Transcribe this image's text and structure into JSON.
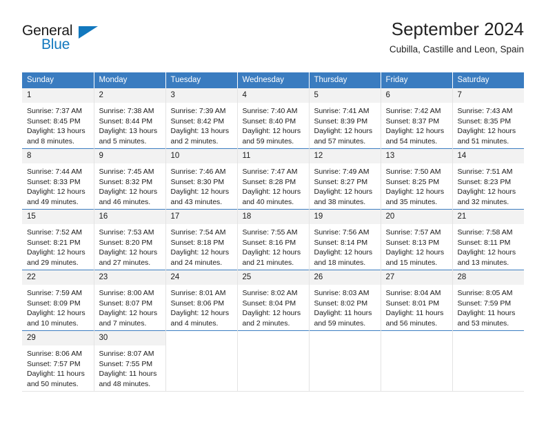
{
  "brand": {
    "line1": "General",
    "line2": "Blue",
    "accent_color": "#1278be"
  },
  "header": {
    "title": "September 2024",
    "subtitle": "Cubilla, Castille and Leon, Spain"
  },
  "calendar": {
    "header_background": "#3a7cc0",
    "daynum_background": "#f2f2f2",
    "weekdays": [
      "Sunday",
      "Monday",
      "Tuesday",
      "Wednesday",
      "Thursday",
      "Friday",
      "Saturday"
    ],
    "weeks": [
      [
        {
          "day": "1",
          "sunrise": "Sunrise: 7:37 AM",
          "sunset": "Sunset: 8:45 PM",
          "daylight_1": "Daylight: 13 hours",
          "daylight_2": "and 8 minutes."
        },
        {
          "day": "2",
          "sunrise": "Sunrise: 7:38 AM",
          "sunset": "Sunset: 8:44 PM",
          "daylight_1": "Daylight: 13 hours",
          "daylight_2": "and 5 minutes."
        },
        {
          "day": "3",
          "sunrise": "Sunrise: 7:39 AM",
          "sunset": "Sunset: 8:42 PM",
          "daylight_1": "Daylight: 13 hours",
          "daylight_2": "and 2 minutes."
        },
        {
          "day": "4",
          "sunrise": "Sunrise: 7:40 AM",
          "sunset": "Sunset: 8:40 PM",
          "daylight_1": "Daylight: 12 hours",
          "daylight_2": "and 59 minutes."
        },
        {
          "day": "5",
          "sunrise": "Sunrise: 7:41 AM",
          "sunset": "Sunset: 8:39 PM",
          "daylight_1": "Daylight: 12 hours",
          "daylight_2": "and 57 minutes."
        },
        {
          "day": "6",
          "sunrise": "Sunrise: 7:42 AM",
          "sunset": "Sunset: 8:37 PM",
          "daylight_1": "Daylight: 12 hours",
          "daylight_2": "and 54 minutes."
        },
        {
          "day": "7",
          "sunrise": "Sunrise: 7:43 AM",
          "sunset": "Sunset: 8:35 PM",
          "daylight_1": "Daylight: 12 hours",
          "daylight_2": "and 51 minutes."
        }
      ],
      [
        {
          "day": "8",
          "sunrise": "Sunrise: 7:44 AM",
          "sunset": "Sunset: 8:33 PM",
          "daylight_1": "Daylight: 12 hours",
          "daylight_2": "and 49 minutes."
        },
        {
          "day": "9",
          "sunrise": "Sunrise: 7:45 AM",
          "sunset": "Sunset: 8:32 PM",
          "daylight_1": "Daylight: 12 hours",
          "daylight_2": "and 46 minutes."
        },
        {
          "day": "10",
          "sunrise": "Sunrise: 7:46 AM",
          "sunset": "Sunset: 8:30 PM",
          "daylight_1": "Daylight: 12 hours",
          "daylight_2": "and 43 minutes."
        },
        {
          "day": "11",
          "sunrise": "Sunrise: 7:47 AM",
          "sunset": "Sunset: 8:28 PM",
          "daylight_1": "Daylight: 12 hours",
          "daylight_2": "and 40 minutes."
        },
        {
          "day": "12",
          "sunrise": "Sunrise: 7:49 AM",
          "sunset": "Sunset: 8:27 PM",
          "daylight_1": "Daylight: 12 hours",
          "daylight_2": "and 38 minutes."
        },
        {
          "day": "13",
          "sunrise": "Sunrise: 7:50 AM",
          "sunset": "Sunset: 8:25 PM",
          "daylight_1": "Daylight: 12 hours",
          "daylight_2": "and 35 minutes."
        },
        {
          "day": "14",
          "sunrise": "Sunrise: 7:51 AM",
          "sunset": "Sunset: 8:23 PM",
          "daylight_1": "Daylight: 12 hours",
          "daylight_2": "and 32 minutes."
        }
      ],
      [
        {
          "day": "15",
          "sunrise": "Sunrise: 7:52 AM",
          "sunset": "Sunset: 8:21 PM",
          "daylight_1": "Daylight: 12 hours",
          "daylight_2": "and 29 minutes."
        },
        {
          "day": "16",
          "sunrise": "Sunrise: 7:53 AM",
          "sunset": "Sunset: 8:20 PM",
          "daylight_1": "Daylight: 12 hours",
          "daylight_2": "and 27 minutes."
        },
        {
          "day": "17",
          "sunrise": "Sunrise: 7:54 AM",
          "sunset": "Sunset: 8:18 PM",
          "daylight_1": "Daylight: 12 hours",
          "daylight_2": "and 24 minutes."
        },
        {
          "day": "18",
          "sunrise": "Sunrise: 7:55 AM",
          "sunset": "Sunset: 8:16 PM",
          "daylight_1": "Daylight: 12 hours",
          "daylight_2": "and 21 minutes."
        },
        {
          "day": "19",
          "sunrise": "Sunrise: 7:56 AM",
          "sunset": "Sunset: 8:14 PM",
          "daylight_1": "Daylight: 12 hours",
          "daylight_2": "and 18 minutes."
        },
        {
          "day": "20",
          "sunrise": "Sunrise: 7:57 AM",
          "sunset": "Sunset: 8:13 PM",
          "daylight_1": "Daylight: 12 hours",
          "daylight_2": "and 15 minutes."
        },
        {
          "day": "21",
          "sunrise": "Sunrise: 7:58 AM",
          "sunset": "Sunset: 8:11 PM",
          "daylight_1": "Daylight: 12 hours",
          "daylight_2": "and 13 minutes."
        }
      ],
      [
        {
          "day": "22",
          "sunrise": "Sunrise: 7:59 AM",
          "sunset": "Sunset: 8:09 PM",
          "daylight_1": "Daylight: 12 hours",
          "daylight_2": "and 10 minutes."
        },
        {
          "day": "23",
          "sunrise": "Sunrise: 8:00 AM",
          "sunset": "Sunset: 8:07 PM",
          "daylight_1": "Daylight: 12 hours",
          "daylight_2": "and 7 minutes."
        },
        {
          "day": "24",
          "sunrise": "Sunrise: 8:01 AM",
          "sunset": "Sunset: 8:06 PM",
          "daylight_1": "Daylight: 12 hours",
          "daylight_2": "and 4 minutes."
        },
        {
          "day": "25",
          "sunrise": "Sunrise: 8:02 AM",
          "sunset": "Sunset: 8:04 PM",
          "daylight_1": "Daylight: 12 hours",
          "daylight_2": "and 2 minutes."
        },
        {
          "day": "26",
          "sunrise": "Sunrise: 8:03 AM",
          "sunset": "Sunset: 8:02 PM",
          "daylight_1": "Daylight: 11 hours",
          "daylight_2": "and 59 minutes."
        },
        {
          "day": "27",
          "sunrise": "Sunrise: 8:04 AM",
          "sunset": "Sunset: 8:01 PM",
          "daylight_1": "Daylight: 11 hours",
          "daylight_2": "and 56 minutes."
        },
        {
          "day": "28",
          "sunrise": "Sunrise: 8:05 AM",
          "sunset": "Sunset: 7:59 PM",
          "daylight_1": "Daylight: 11 hours",
          "daylight_2": "and 53 minutes."
        }
      ],
      [
        {
          "day": "29",
          "sunrise": "Sunrise: 8:06 AM",
          "sunset": "Sunset: 7:57 PM",
          "daylight_1": "Daylight: 11 hours",
          "daylight_2": "and 50 minutes."
        },
        {
          "day": "30",
          "sunrise": "Sunrise: 8:07 AM",
          "sunset": "Sunset: 7:55 PM",
          "daylight_1": "Daylight: 11 hours",
          "daylight_2": "and 48 minutes."
        },
        {
          "day": "",
          "sunrise": "",
          "sunset": "",
          "daylight_1": "",
          "daylight_2": ""
        },
        {
          "day": "",
          "sunrise": "",
          "sunset": "",
          "daylight_1": "",
          "daylight_2": ""
        },
        {
          "day": "",
          "sunrise": "",
          "sunset": "",
          "daylight_1": "",
          "daylight_2": ""
        },
        {
          "day": "",
          "sunrise": "",
          "sunset": "",
          "daylight_1": "",
          "daylight_2": ""
        },
        {
          "day": "",
          "sunrise": "",
          "sunset": "",
          "daylight_1": "",
          "daylight_2": ""
        }
      ]
    ]
  }
}
